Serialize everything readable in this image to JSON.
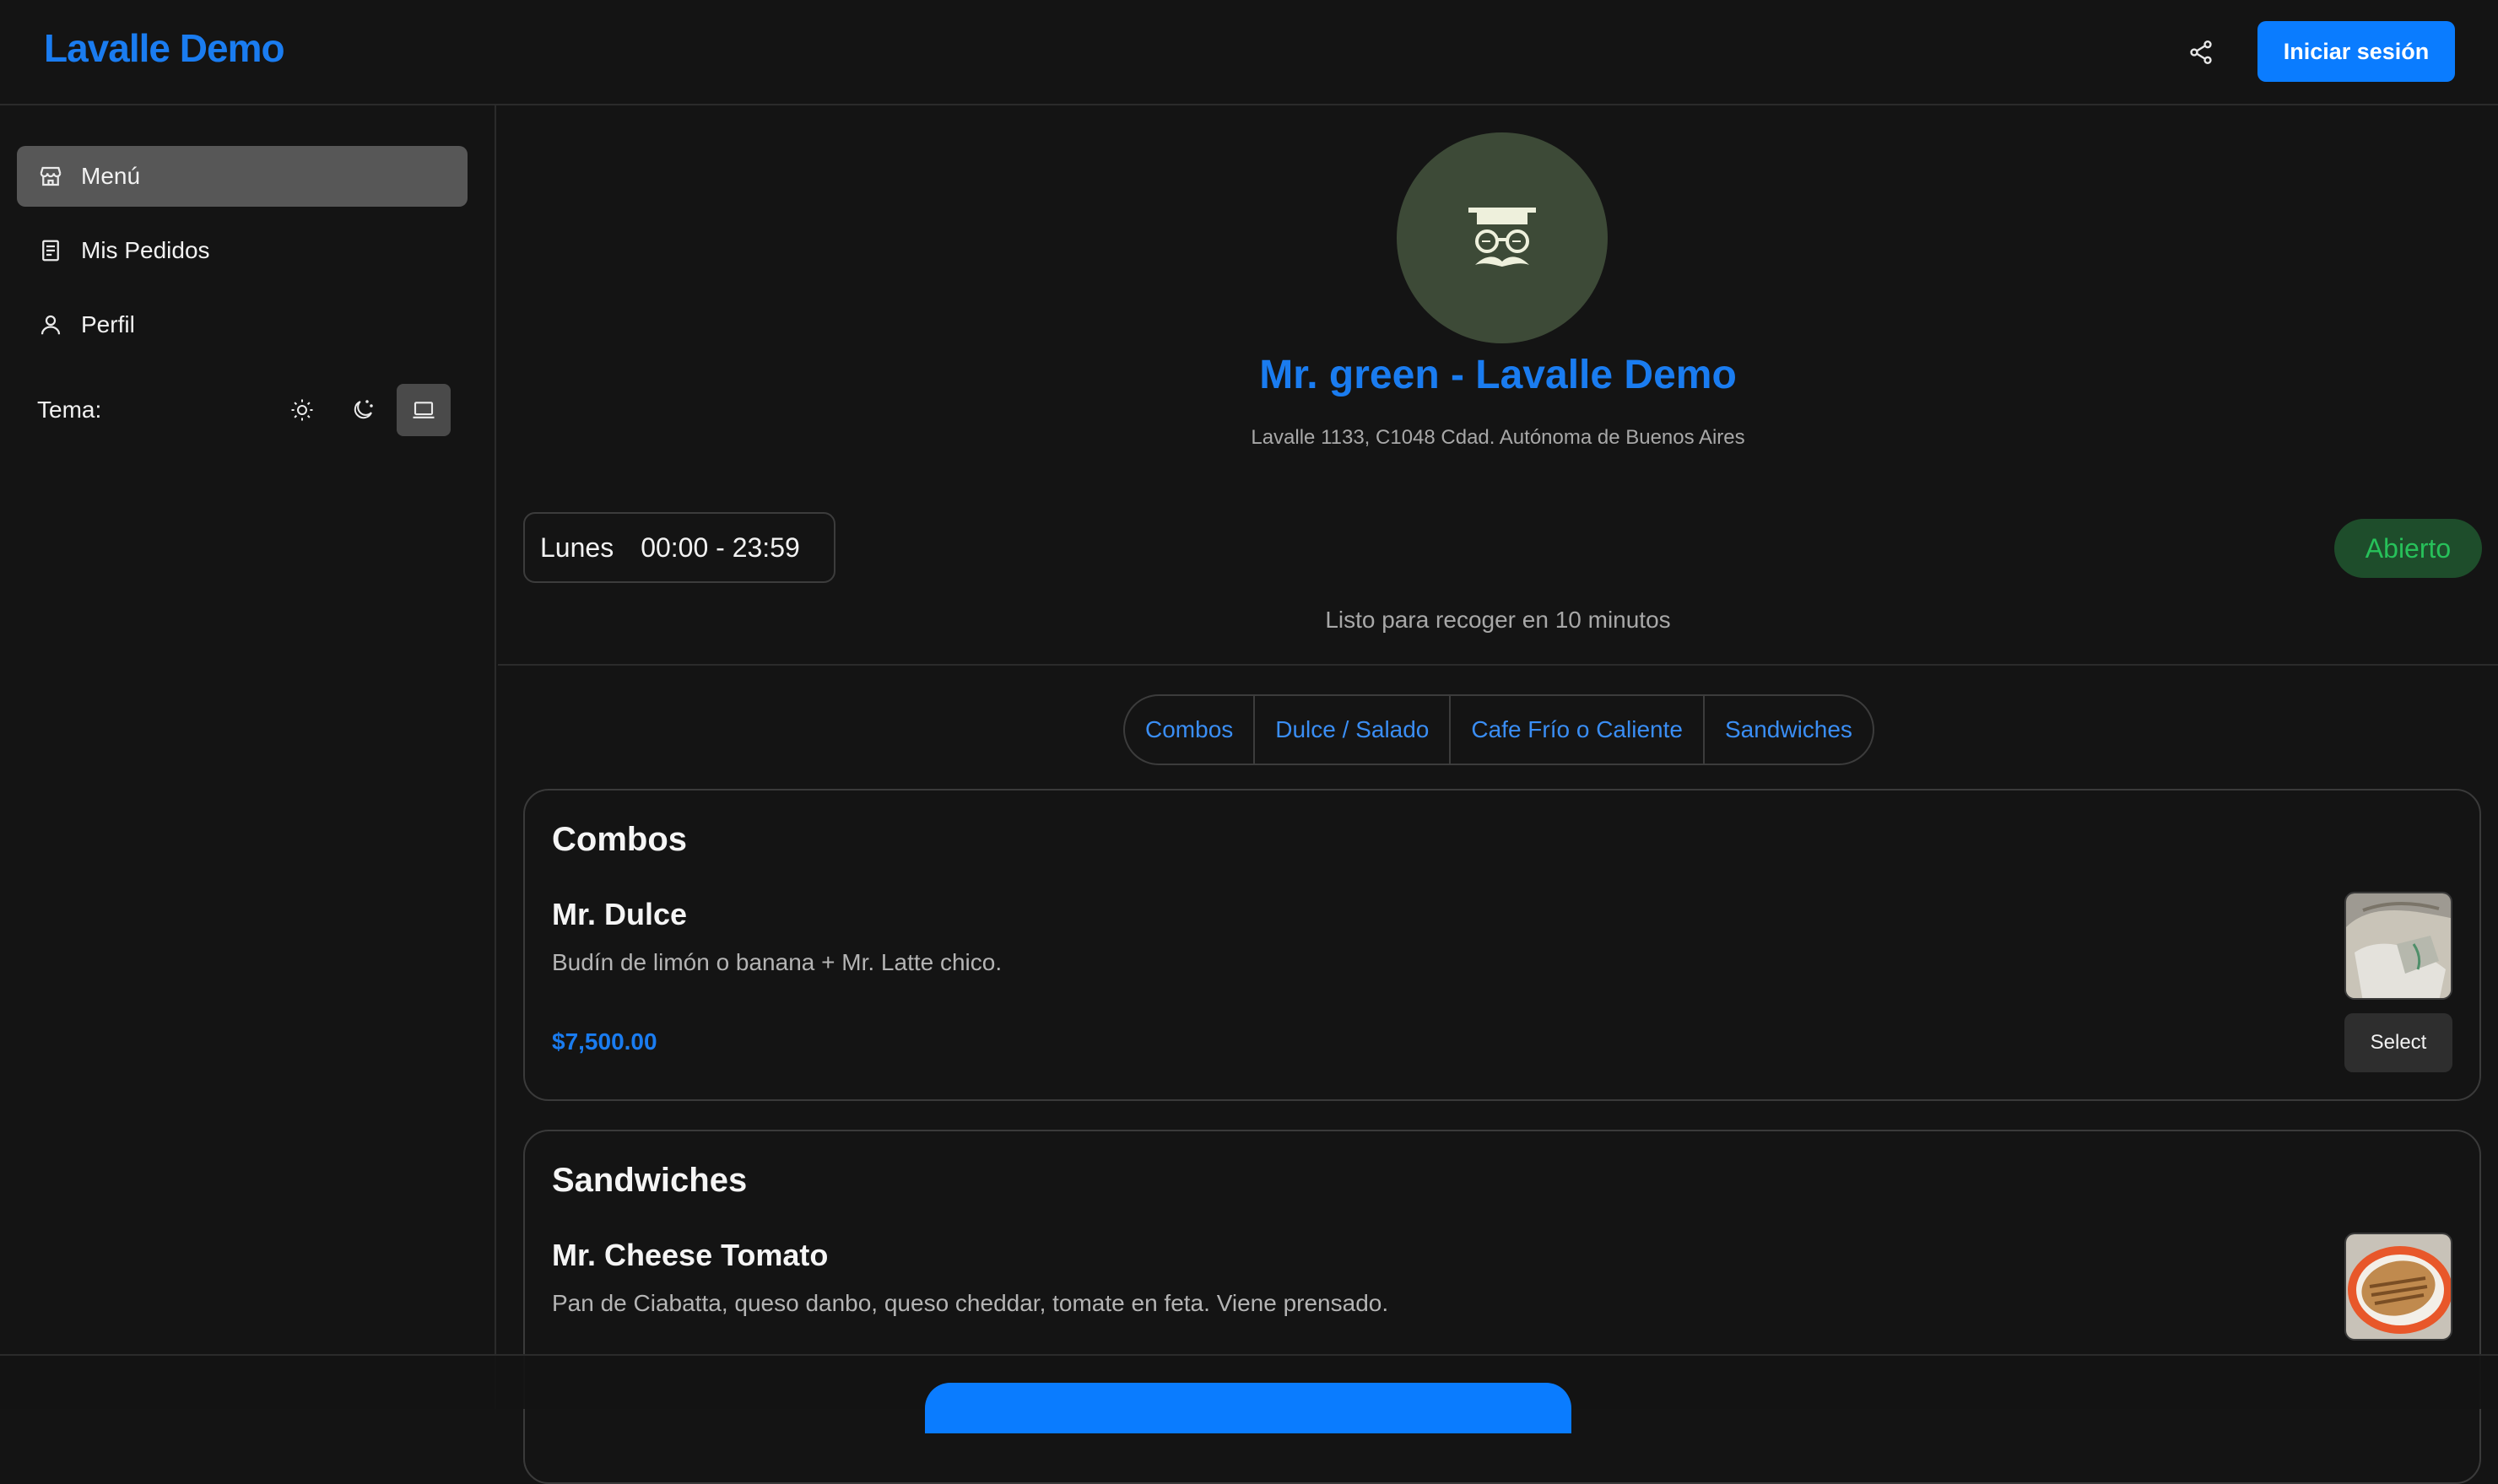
{
  "header": {
    "brand": "Lavalle Demo",
    "login_label": "Iniciar sesión"
  },
  "sidebar": {
    "items": [
      {
        "label": "Menú",
        "icon": "store-icon",
        "active": true
      },
      {
        "label": "Mis Pedidos",
        "icon": "receipt-icon",
        "active": false
      },
      {
        "label": "Perfil",
        "icon": "user-icon",
        "active": false
      }
    ],
    "theme_label": "Tema:",
    "theme_options": [
      "sun-icon",
      "moon-icon",
      "laptop-icon"
    ],
    "theme_selected": "laptop-icon"
  },
  "store": {
    "name": "Mr. green - Lavalle Demo",
    "address": "Lavalle 1133, C1048 Cdad. Autónoma de Buenos Aires",
    "day": "Lunes",
    "hours": "00:00 - 23:59",
    "status": "Abierto",
    "pickup": "Listo para recoger en 10 minutos"
  },
  "categories": [
    "Combos",
    "Dulce / Salado",
    "Cafe Frío o Caliente",
    "Sandwiches"
  ],
  "sections": [
    {
      "title": "Combos",
      "items": [
        {
          "name": "Mr. Dulce",
          "description": "Budín de limón o banana + Mr. Latte chico.",
          "price": "$7,500.00",
          "select_label": "Select"
        }
      ]
    },
    {
      "title": "Sandwiches",
      "items": [
        {
          "name": "Mr. Cheese Tomato",
          "description": "Pan de Ciabatta, queso danbo, queso cheddar, tomate en feta. Viene prensado."
        }
      ]
    }
  ],
  "colors": {
    "accent": "#1a7cf0",
    "primary_button": "#0a7cff",
    "open_badge_bg": "#1e4d2b",
    "open_badge_text": "#27c15a",
    "avatar_bg": "#3d4a37"
  }
}
